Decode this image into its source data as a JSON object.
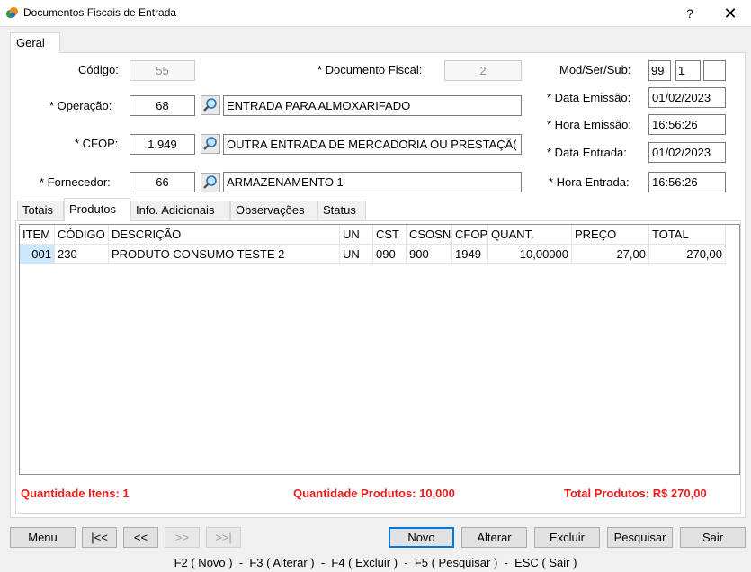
{
  "window": {
    "title": "Documentos Fiscais de Entrada",
    "help": "?",
    "close": "✕"
  },
  "tab_geral": "Geral",
  "form": {
    "codigo": {
      "label": "Código:",
      "value": "55"
    },
    "documento_fiscal": {
      "label": "* Documento Fiscal:",
      "value": "2"
    },
    "mod_ser_sub": {
      "label": "Mod/Ser/Sub:",
      "mod": "99",
      "ser": "1",
      "sub": ""
    },
    "operacao": {
      "label": "* Operação:",
      "code": "68",
      "desc": "ENTRADA PARA ALMOXARIFADO"
    },
    "data_emissao": {
      "label": "* Data Emissão:",
      "value": "01/02/2023"
    },
    "hora_emissao": {
      "label": "* Hora Emissão:",
      "value": "16:56:26"
    },
    "cfop": {
      "label": "* CFOP:",
      "code": "1.949",
      "desc": "OUTRA ENTRADA DE MERCADORIA OU PRESTAÇÃ("
    },
    "data_entrada": {
      "label": "* Data Entrada:",
      "value": "01/02/2023"
    },
    "fornecedor": {
      "label": "* Fornecedor:",
      "code": "66",
      "desc": "ARMAZENAMENTO 1"
    },
    "hora_entrada": {
      "label": "* Hora Entrada:",
      "value": "16:56:26"
    }
  },
  "subtabs": [
    "Totais",
    "Produtos",
    "Info. Adicionais",
    "Observações",
    "Status"
  ],
  "grid": {
    "headers": [
      "ITEM",
      "CÓDIGO",
      "DESCRIÇÃO",
      "UN",
      "CST",
      "CSOSN",
      "CFOP",
      "QUANT.",
      "PREÇO",
      "TOTAL"
    ],
    "rows": [
      [
        "001",
        "230",
        "PRODUTO CONSUMO TESTE 2",
        "UN",
        "090",
        "900",
        "1949",
        "10,00000",
        "27,00",
        "270,00"
      ]
    ]
  },
  "totals": {
    "qtd_itens": "Quantidade Itens: 1",
    "qtd_produtos": "Quantidade Produtos: 10,000",
    "total_produtos": "Total Produtos: R$ 270,00"
  },
  "buttons": {
    "menu": "Menu",
    "first": "|<<",
    "prev": "<<",
    "next": ">>",
    "last": ">>|",
    "novo": "Novo",
    "alterar": "Alterar",
    "excluir": "Excluir",
    "pesquisar": "Pesquisar",
    "sair": "Sair"
  },
  "shortcuts": "F2 ( Novo )  -  F3 ( Alterar )  -  F4 ( Excluir )  -  F5 ( Pesquisar )  -  ESC ( Sair )",
  "colors": {
    "accent": "#0078d7",
    "total_red": "#e81e1e",
    "selected_cell": "#cce8ff"
  }
}
